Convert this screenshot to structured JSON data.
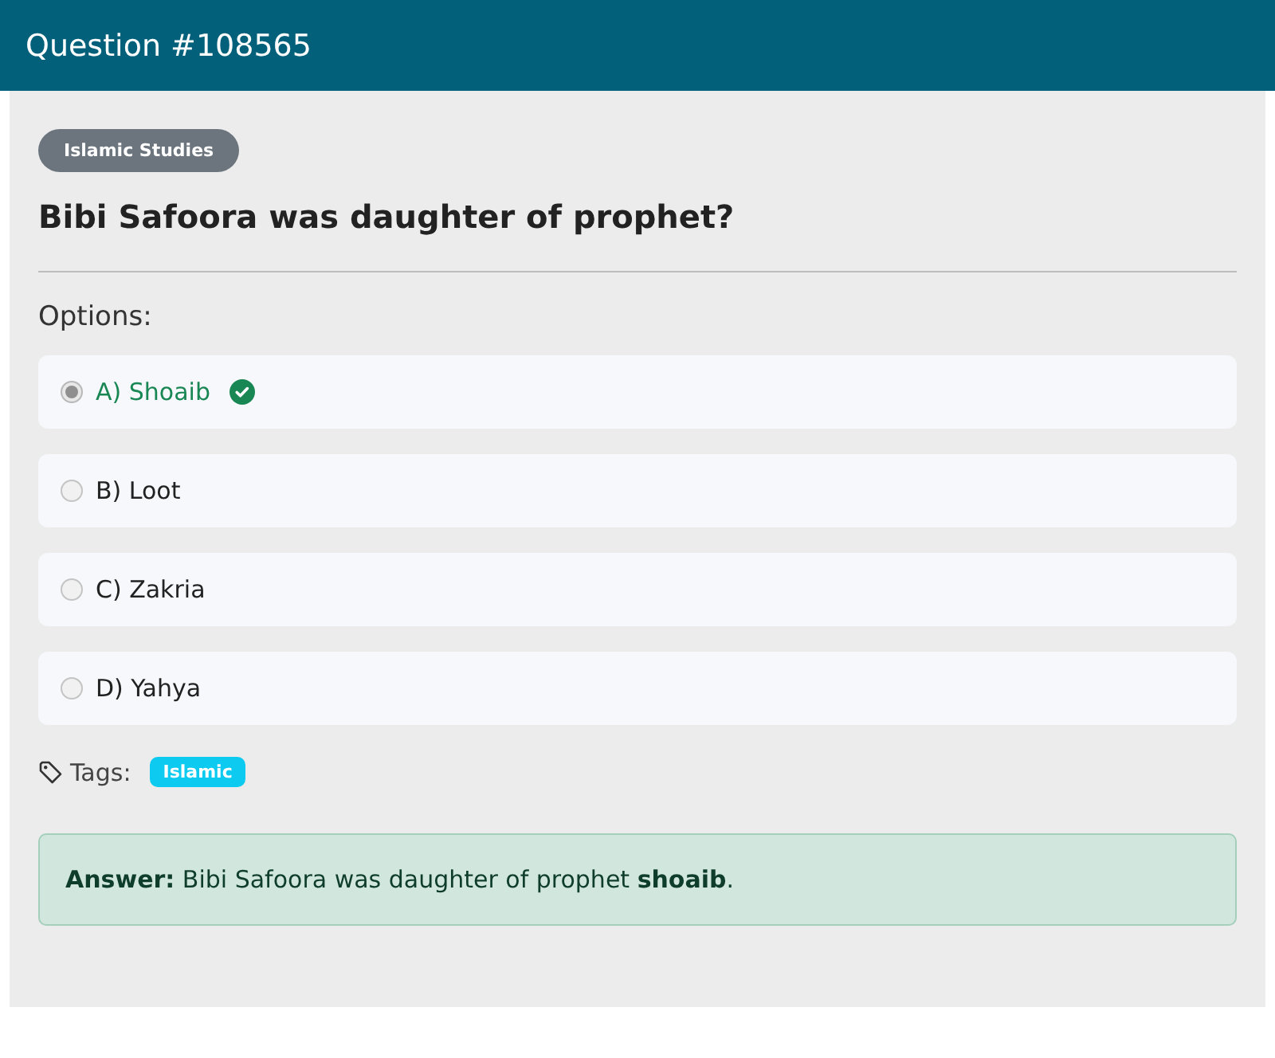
{
  "header": {
    "title": "Question #108565"
  },
  "category": "Islamic Studies",
  "question": "Bibi Safoora was daughter of prophet?",
  "options_label": "Options:",
  "options": [
    {
      "label": "A) Shoaib",
      "selected": true,
      "correct": true
    },
    {
      "label": "B) Loot",
      "selected": false,
      "correct": false
    },
    {
      "label": "C) Zakria",
      "selected": false,
      "correct": false
    },
    {
      "label": "D) Yahya",
      "selected": false,
      "correct": false
    }
  ],
  "tags_label": "Tags:",
  "tags": [
    "Islamic"
  ],
  "answer": "**Answer:** Bibi Safoora was daughter of prophet **shoaib**."
}
